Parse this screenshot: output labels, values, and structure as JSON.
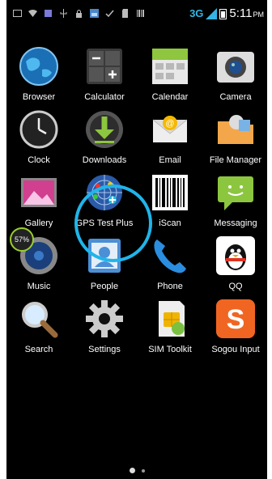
{
  "status": {
    "network": "3G",
    "time": "5:11",
    "ampm": "PM"
  },
  "apps": [
    {
      "label": "Browser",
      "icon": "globe-icon"
    },
    {
      "label": "Calculator",
      "icon": "calculator-icon"
    },
    {
      "label": "Calendar",
      "icon": "calendar-icon"
    },
    {
      "label": "Camera",
      "icon": "camera-icon"
    },
    {
      "label": "Clock",
      "icon": "clock-icon"
    },
    {
      "label": "Downloads",
      "icon": "download-icon"
    },
    {
      "label": "Email",
      "icon": "envelope-icon"
    },
    {
      "label": "File Manager",
      "icon": "folder-icon"
    },
    {
      "label": "Gallery",
      "icon": "gallery-icon"
    },
    {
      "label": "GPS Test Plus",
      "icon": "gps-radar-icon"
    },
    {
      "label": "iScan",
      "icon": "barcode-icon"
    },
    {
      "label": "Messaging",
      "icon": "chat-bubble-icon"
    },
    {
      "label": "Music",
      "icon": "speaker-icon"
    },
    {
      "label": "People",
      "icon": "contact-card-icon"
    },
    {
      "label": "Phone",
      "icon": "phone-handset-icon"
    },
    {
      "label": "QQ",
      "icon": "penguin-icon"
    },
    {
      "label": "Search",
      "icon": "magnifier-icon"
    },
    {
      "label": "Settings",
      "icon": "gear-icon"
    },
    {
      "label": "SIM Toolkit",
      "icon": "sim-card-icon"
    },
    {
      "label": "Sogou Input",
      "icon": "sogou-s-icon"
    }
  ],
  "overlay": {
    "badge_text": "57%"
  },
  "pager": {
    "pages": 2,
    "current": 1
  }
}
